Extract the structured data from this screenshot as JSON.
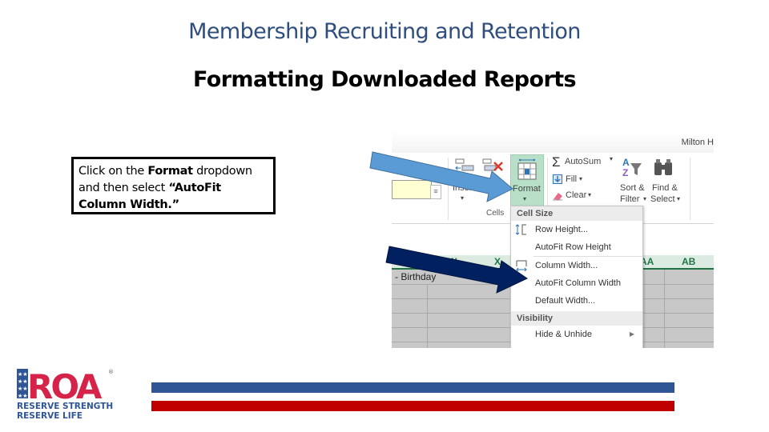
{
  "slide": {
    "subtitle": "Membership Recruiting and Retention",
    "title": "Formatting Downloaded Reports",
    "callout": {
      "part1": "Click on the ",
      "bold1": "Format",
      "part2": " dropdown and then select ",
      "bold2": "“AutoFit Column Width.”"
    }
  },
  "excel": {
    "user_name": "Milton H",
    "ribbon": {
      "insert_label": "Insert",
      "format_label": "Format",
      "cells_group_label": "Cells",
      "autosum_label": "AutoSum",
      "fill_label": "Fill",
      "clear_label": "Clear",
      "sort_label_1": "Sort &",
      "sort_label_2": "Filter",
      "find_label_1": "Find &",
      "find_label_2": "Select"
    },
    "format_menu": {
      "sections": [
        {
          "header": "Cell Size"
        },
        {
          "header": "Visibility"
        }
      ],
      "items": [
        {
          "label": "Row Height...",
          "icon": "row-height-icon"
        },
        {
          "label": "AutoFit Row Height"
        },
        {
          "label": "Column Width...",
          "icon": "column-width-icon"
        },
        {
          "label": "AutoFit Column Width"
        },
        {
          "label": "Default Width..."
        },
        {
          "label": "Hide & Unhide",
          "submenu": true
        }
      ]
    },
    "columns": [
      "W",
      "X",
      "AA",
      "AB"
    ],
    "cell_text": "- Birthday"
  },
  "logo": {
    "name": "ROA",
    "tagline_1": "RESERVE STRENGTH",
    "tagline_2": "RESERVE LIFE",
    "registered": "®"
  },
  "colors": {
    "brand_blue": "#2f5597",
    "brand_red": "#c00000",
    "excel_green": "#217346",
    "arrow_light": "#5b9bd5",
    "arrow_dark": "#002060"
  }
}
